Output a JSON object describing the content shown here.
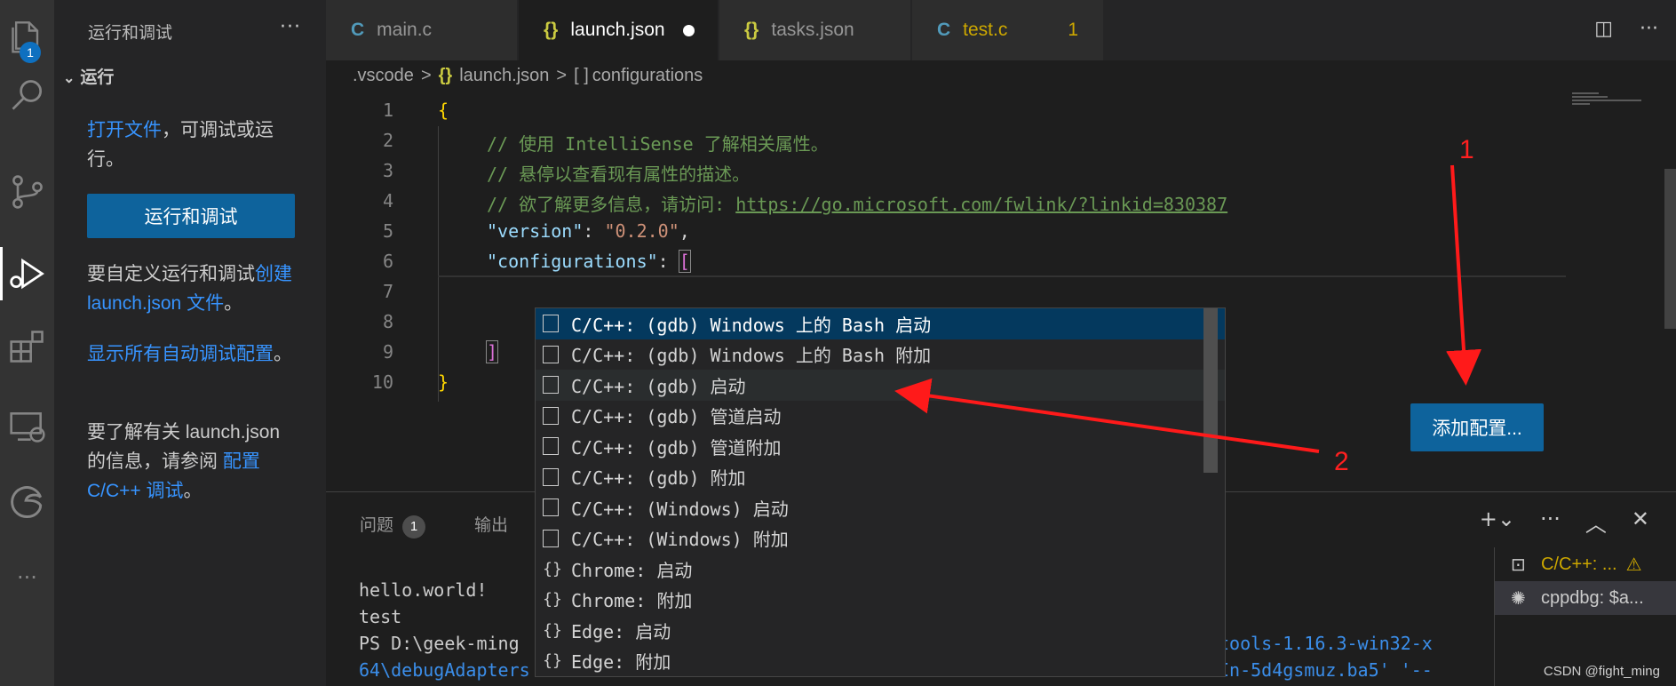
{
  "activity_bar": {
    "explorer_badge": "1",
    "icons": [
      "files-icon",
      "search-icon",
      "source-control-icon",
      "run-debug-icon",
      "extensions-icon",
      "remote-explorer-icon",
      "edge-icon",
      "more-icon"
    ]
  },
  "sidebar": {
    "title": "运行和调试",
    "more": "···",
    "section": "运行",
    "open_file_link": "打开文件",
    "open_file_rest": "，可调试或运行。",
    "run_button": "运行和调试",
    "customize_prefix": "要自定义运行和调试",
    "customize_link": "创建 launch.json 文件",
    "customize_suffix": "。",
    "show_all_link": "显示所有自动调试配置",
    "show_all_suffix": "。",
    "learn_prefix": "要了解有关 launch.json 的信息，请参阅 ",
    "learn_link": "配置 C/C++ 调试",
    "learn_suffix": "。"
  },
  "tabs": [
    {
      "icon": "C",
      "label": "main.c"
    },
    {
      "icon": "{}",
      "label": "launch.json"
    },
    {
      "icon": "{}",
      "label": "tasks.json"
    },
    {
      "icon": "C",
      "label": "test.c",
      "count": "1"
    }
  ],
  "breadcrumb": {
    "folder": ".vscode",
    "file_icon": "{}",
    "file": "launch.json",
    "symbol_icon": "[ ]",
    "symbol": "configurations"
  },
  "editor": {
    "line_numbers": [
      "1",
      "2",
      "3",
      "4",
      "5",
      "6",
      "7",
      "8",
      "9",
      "10"
    ],
    "line1": "{",
    "line2": "// 使用 IntelliSense 了解相关属性。",
    "line3": "// 悬停以查看现有属性的描述。",
    "line4_comment": "// 欲了解更多信息，请访问: ",
    "line4_url": "https://go.microsoft.com/fwlink/?linkid=830387",
    "line5_key": "\"version\"",
    "line5_value": "\"0.2.0\"",
    "line6_key": "\"configurations\"",
    "line6_bracket": "[",
    "line9": "]",
    "line10": "}"
  },
  "add_config_button": "添加配置...",
  "suggestions": [
    {
      "icon": "box",
      "label": "C/C++: (gdb) Windows 上的 Bash 启动"
    },
    {
      "icon": "box",
      "label": "C/C++: (gdb) Windows 上的 Bash 附加"
    },
    {
      "icon": "box",
      "label": "C/C++: (gdb) 启动"
    },
    {
      "icon": "box",
      "label": "C/C++: (gdb) 管道启动"
    },
    {
      "icon": "box",
      "label": "C/C++: (gdb) 管道附加"
    },
    {
      "icon": "box",
      "label": "C/C++: (gdb) 附加"
    },
    {
      "icon": "box",
      "label": "C/C++: (Windows) 启动"
    },
    {
      "icon": "box",
      "label": "C/C++: (Windows) 附加"
    },
    {
      "icon": "{}",
      "label": "Chrome: 启动"
    },
    {
      "icon": "{}",
      "label": "Chrome: 附加"
    },
    {
      "icon": "{}",
      "label": "Edge: 启动"
    },
    {
      "icon": "{}",
      "label": "Edge: 附加"
    }
  ],
  "panel": {
    "problems_label": "问题",
    "problems_count": "1",
    "output_label": "输出",
    "terminal_lines": [
      "hello.world!",
      "test",
      "PS D:\\geek-ming"
    ],
    "terminal_line_blue_right": "tools-1.16.3-win32-x",
    "terminal_line_blue_left": "64\\debugAdapters",
    "terminal_line_blue_tail": "In-5d4gsmuz.ba5' '--",
    "terminals": [
      {
        "label": "C/C++: ...",
        "warn": "⚠"
      },
      {
        "label": "cppdbg: $a..."
      }
    ]
  },
  "annotations": {
    "label1": "1",
    "label2": "2"
  },
  "watermark": "CSDN @fight_ming"
}
